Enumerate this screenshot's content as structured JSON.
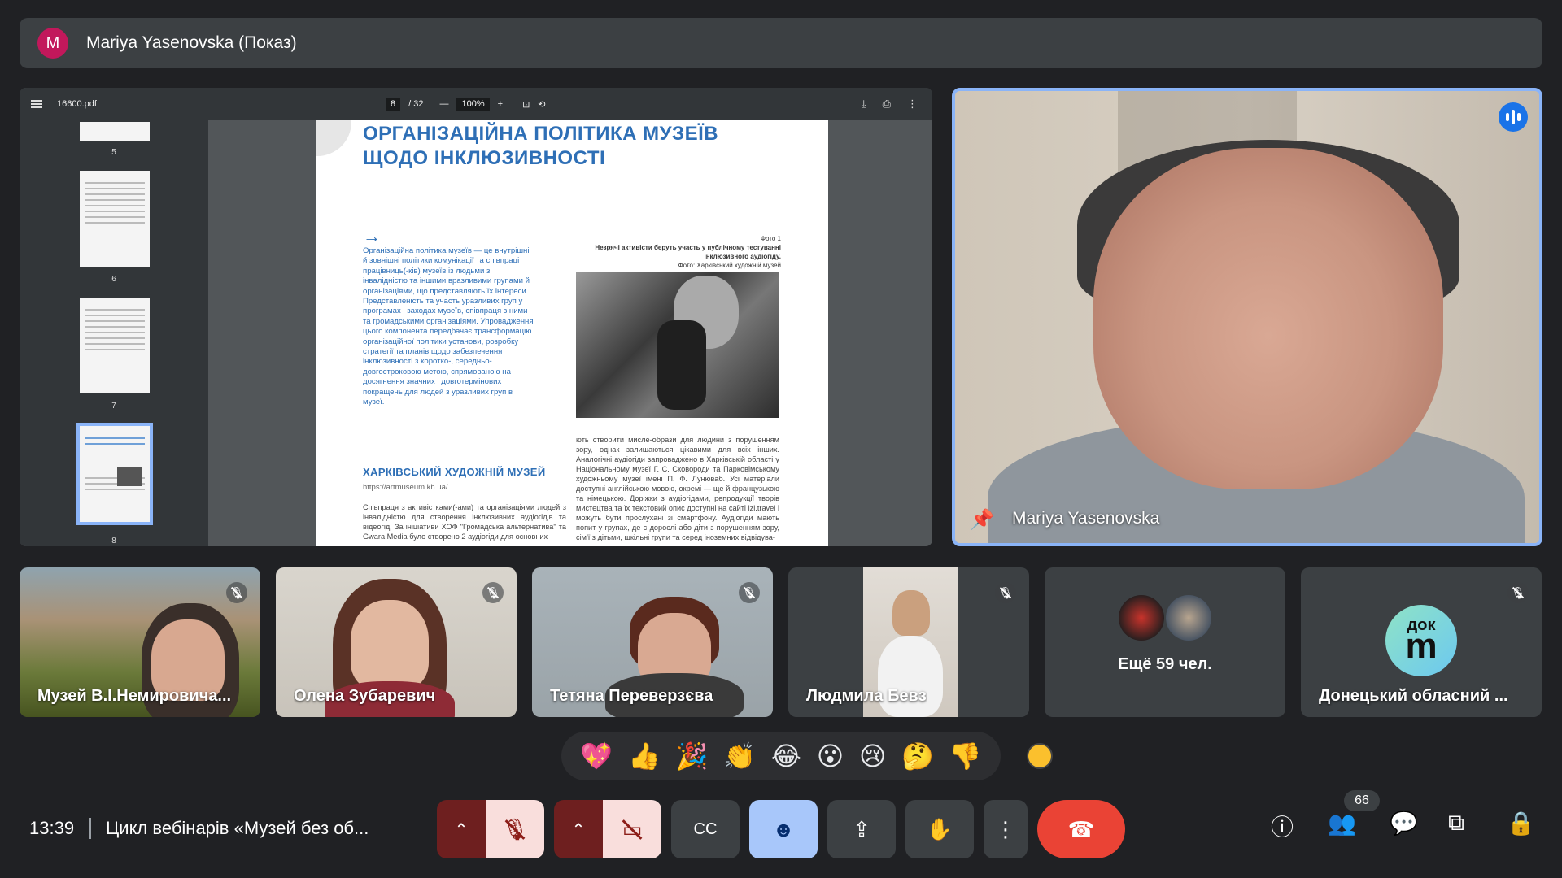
{
  "presenter": {
    "initial": "M",
    "title": "Mariya Yasenovska (Показ)",
    "avatar_color": "#c2185b"
  },
  "pdf": {
    "filename": "16600.pdf",
    "page_current": "8",
    "page_total": "/ 32",
    "zoom": "100%",
    "thumbs": [
      "5",
      "6",
      "7",
      "8"
    ],
    "heading_line1": "ОРГАНІЗАЦІЙНА ПОЛІТИКА МУЗЕЇВ",
    "heading_line2": "ЩОДО ІНКЛЮЗИВНОСТІ",
    "intro_text": "Організаційна політика музеїв — це внутрішні й зовнішні політики комунікації та співпраці працівниць(-ків) музеїв із людьми з інвалідністю та іншими вразливими групами й організаціями, що представляють їх інтереси. Представленість та участь уразливих груп у програмах і заходах музеїв, співпраця з ними та громадськими організаціями. Упровадження цього компонента передбачає трансформацію організаційної політики установи, розробку стратегії та планів щодо забезпечення інклюзивності з коротко-, середньо- і довгостроковою метою, спрямованою на досягнення значних і довготермінових покращень для людей з уразливих груп в музеї.",
    "museum_name": "ХАРКІВСЬКИЙ ХУДОЖНІЙ МУЗЕЙ",
    "museum_url": "https://artmuseum.kh.ua/",
    "body_left": "Співпраця з активістками(-ами) та організаціями людей з інвалідністю для створення інклюзивних аудіогідів та відеогід. За ініціативи ХОФ \"Громадська альтернатива\" та Gwara Media було створено 2 аудіогіди для основних",
    "foto_label": "Фото 1",
    "foto_caption": "Незрячі активісти беруть участь у публічному тестуванні інклюзивного аудіогіду.",
    "foto_credit": "Фото: Харківський художній музей",
    "body_right": "ють створити мисле-образи для людини з порушенням зору, однак залишаються цікавими для всіх інших. Аналогічні аудіогіди запроваджено в Харківській області у Національному музеї Г. С. Сковороди та Парковімському художньому музеї імені П. Ф. Лунюваб. Усі матеріали доступні англійською мовою, окремі — ще й французькою та німецькою. Доріжки з аудіогідами, репродукції творів мистецтва та їх текстовий опис доступні на сайті izi.travel і можуть бути прослухані зі смартфону. Аудіогіди мають попит у групах, де є дорослі або діти з порушенням зору, сім'ї з дітьми, шкільні групи та серед іноземних відвідува-"
  },
  "speaker": {
    "name": "Mariya Yasenovska",
    "accent": "#8ab4f8"
  },
  "participants": [
    {
      "name": "Музей В.І.Немировича..."
    },
    {
      "name": "Олена Зубаревич"
    },
    {
      "name": "Тетяна Переверзєва"
    },
    {
      "name": "Людмила Бевз"
    },
    {
      "name": "Ещё 59 чел."
    },
    {
      "name": "Донецький обласний ..."
    }
  ],
  "dok_logo": {
    "top": "док",
    "bottom": "m"
  },
  "reactions": [
    "💖",
    "👍",
    "🎉",
    "👏",
    "😂",
    "😮",
    "😢",
    "🤔",
    "👎"
  ],
  "bottom": {
    "time": "13:39",
    "meeting_title": "Цикл вебінарів «Музей без об...",
    "participants_count": "66",
    "end_call_color": "#ea4335"
  }
}
